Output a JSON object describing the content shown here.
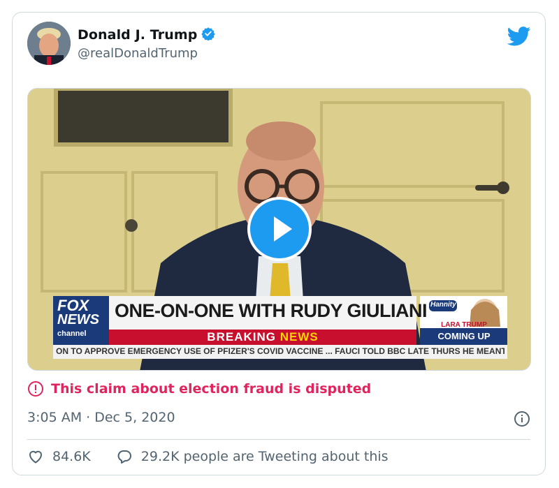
{
  "author": {
    "name": "Donald J. Trump",
    "handle": "@realDonaldTrump",
    "verified": true
  },
  "media": {
    "type": "video",
    "network_logo_top": "FOX",
    "network_logo_bottom": "NEWS",
    "network_logo_sub": "channel",
    "headline": "ONE-ON-ONE WITH RUDY GIULIANI",
    "banner_part1": "BREAKING ",
    "banner_part2": "NEWS",
    "show_badge": "Hannity",
    "promo_line1": "LARA TRUMP",
    "promo_line2": "COMING UP",
    "ticker": "ON TO APPROVE EMERGENCY USE OF PFIZER'S COVID VACCINE ...   FAUCI TOLD BBC LATE THURS HE MEANT"
  },
  "notice": {
    "text": "This claim about election fraud is disputed",
    "color": "#e0245e"
  },
  "timestamp": "3:05 AM · Dec 5, 2020",
  "stats": {
    "likes": "84.6K",
    "retweet_text": "29.2K people are Tweeting about this"
  },
  "colors": {
    "brand_blue": "#1d9bf0",
    "secondary_text": "#536471",
    "border": "#cfd9de"
  },
  "icons": [
    "verified-badge-icon",
    "twitter-bird-icon",
    "play-icon",
    "alert-icon",
    "info-icon",
    "heart-icon",
    "reply-icon"
  ]
}
